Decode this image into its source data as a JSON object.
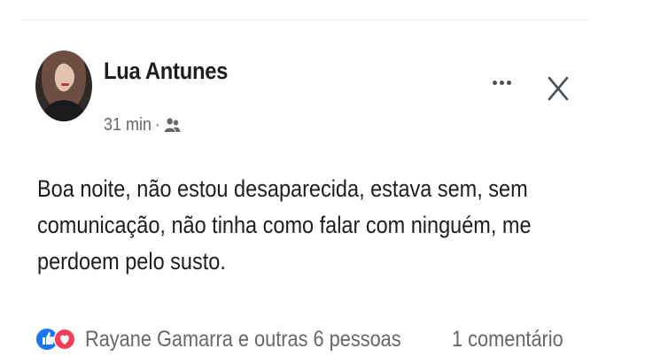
{
  "post": {
    "author_name": "Lua Antunes",
    "timestamp": "31 min",
    "separator": "·",
    "audience_icon": "friends-icon",
    "body_lines": [
      "Boa noite, não estou desaparecida, estava sem, sem",
      "comunicação, não tinha como falar com ninguém, me",
      "perdoem pelo susto."
    ],
    "reactions": {
      "icons": [
        "like-reaction-icon",
        "love-reaction-icon"
      ],
      "summary": "Rayane Gamarra e outras 6 pessoas",
      "comments": "1 comentário"
    }
  },
  "actions": {
    "more_icon": "more-options-icon",
    "close_icon": "close-icon"
  },
  "colors": {
    "text_primary": "#1c1e21",
    "text_secondary": "#65676b",
    "like_blue": "#1877f2",
    "love_red": "#f33e58"
  }
}
